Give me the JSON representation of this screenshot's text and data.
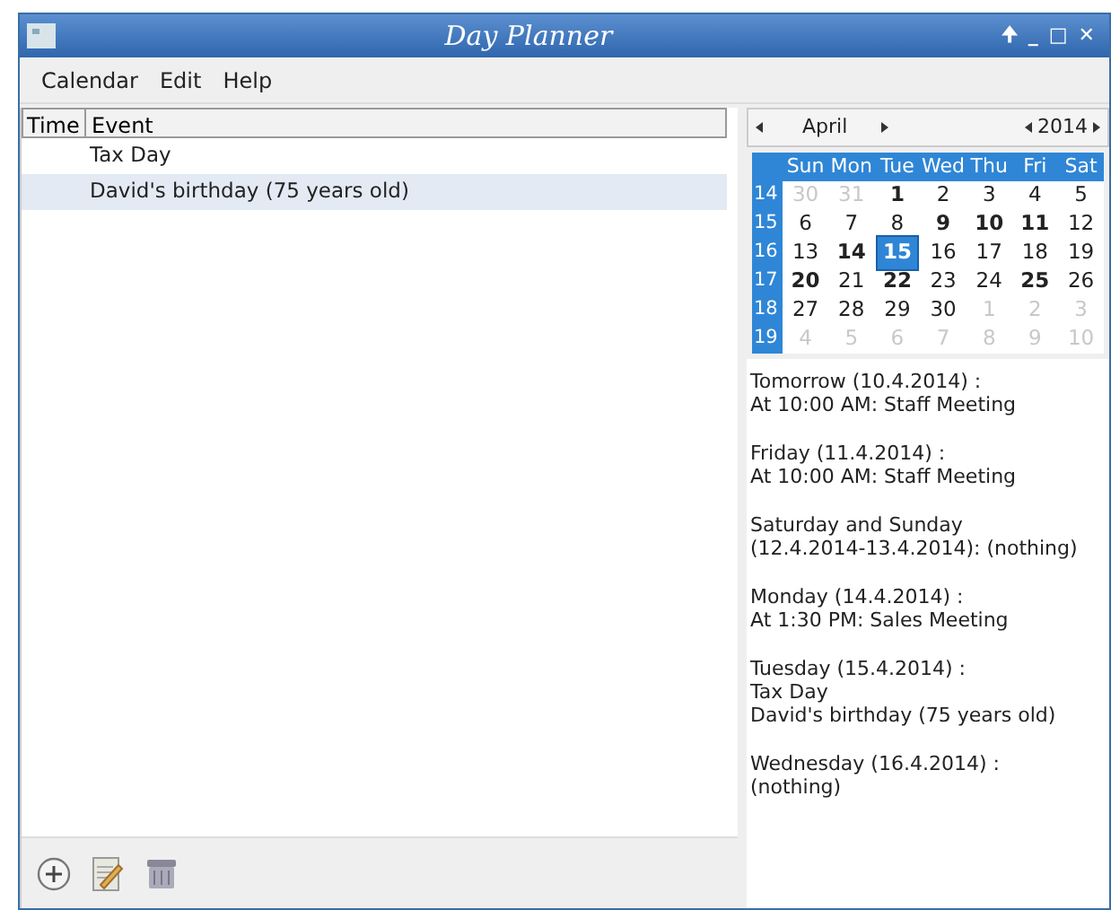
{
  "window": {
    "title": "Day Planner",
    "controls": [
      "🠉",
      "_",
      "□",
      "✕"
    ]
  },
  "menu": [
    "Calendar",
    "Edit",
    "Help"
  ],
  "table": {
    "columns": [
      "Time",
      "Event"
    ],
    "rows": [
      {
        "time": "",
        "event": "Tax Day",
        "selected": false
      },
      {
        "time": "",
        "event": "David's birthday (75 years old)",
        "selected": true
      }
    ]
  },
  "toolbar": [
    {
      "kind": "add"
    },
    {
      "kind": "edit"
    },
    {
      "kind": "delete"
    }
  ],
  "calendar": {
    "month": "April",
    "year": "2014",
    "weekdays": [
      "Sun",
      "Mon",
      "Tue",
      "Wed",
      "Thu",
      "Fri",
      "Sat"
    ],
    "weeks": [
      {
        "number": "14",
        "days": [
          {
            "day": "30",
            "muted": true,
            "bold": false,
            "selected": false
          },
          {
            "day": "31",
            "muted": true,
            "bold": false,
            "selected": false
          },
          {
            "day": "1",
            "muted": false,
            "bold": true,
            "selected": false
          },
          {
            "day": "2",
            "muted": false,
            "bold": false,
            "selected": false
          },
          {
            "day": "3",
            "muted": false,
            "bold": false,
            "selected": false
          },
          {
            "day": "4",
            "muted": false,
            "bold": false,
            "selected": false
          },
          {
            "day": "5",
            "muted": false,
            "bold": false,
            "selected": false
          }
        ]
      },
      {
        "number": "15",
        "days": [
          {
            "day": "6",
            "muted": false,
            "bold": false,
            "selected": false
          },
          {
            "day": "7",
            "muted": false,
            "bold": false,
            "selected": false
          },
          {
            "day": "8",
            "muted": false,
            "bold": false,
            "selected": false
          },
          {
            "day": "9",
            "muted": false,
            "bold": true,
            "selected": false
          },
          {
            "day": "10",
            "muted": false,
            "bold": true,
            "selected": false
          },
          {
            "day": "11",
            "muted": false,
            "bold": true,
            "selected": false
          },
          {
            "day": "12",
            "muted": false,
            "bold": false,
            "selected": false
          }
        ]
      },
      {
        "number": "16",
        "days": [
          {
            "day": "13",
            "muted": false,
            "bold": false,
            "selected": false
          },
          {
            "day": "14",
            "muted": false,
            "bold": true,
            "selected": false
          },
          {
            "day": "15",
            "muted": false,
            "bold": true,
            "selected": true
          },
          {
            "day": "16",
            "muted": false,
            "bold": false,
            "selected": false
          },
          {
            "day": "17",
            "muted": false,
            "bold": false,
            "selected": false
          },
          {
            "day": "18",
            "muted": false,
            "bold": false,
            "selected": false
          },
          {
            "day": "19",
            "muted": false,
            "bold": false,
            "selected": false
          }
        ]
      },
      {
        "number": "17",
        "days": [
          {
            "day": "20",
            "muted": false,
            "bold": true,
            "selected": false
          },
          {
            "day": "21",
            "muted": false,
            "bold": false,
            "selected": false
          },
          {
            "day": "22",
            "muted": false,
            "bold": true,
            "selected": false
          },
          {
            "day": "23",
            "muted": false,
            "bold": false,
            "selected": false
          },
          {
            "day": "24",
            "muted": false,
            "bold": false,
            "selected": false
          },
          {
            "day": "25",
            "muted": false,
            "bold": true,
            "selected": false
          },
          {
            "day": "26",
            "muted": false,
            "bold": false,
            "selected": false
          }
        ]
      },
      {
        "number": "18",
        "days": [
          {
            "day": "27",
            "muted": false,
            "bold": false,
            "selected": false
          },
          {
            "day": "28",
            "muted": false,
            "bold": false,
            "selected": false
          },
          {
            "day": "29",
            "muted": false,
            "bold": false,
            "selected": false
          },
          {
            "day": "30",
            "muted": false,
            "bold": false,
            "selected": false
          },
          {
            "day": "1",
            "muted": true,
            "bold": false,
            "selected": false
          },
          {
            "day": "2",
            "muted": true,
            "bold": false,
            "selected": false
          },
          {
            "day": "3",
            "muted": true,
            "bold": false,
            "selected": false
          }
        ]
      },
      {
        "number": "19",
        "days": [
          {
            "day": "4",
            "muted": true,
            "bold": false,
            "selected": false
          },
          {
            "day": "5",
            "muted": true,
            "bold": false,
            "selected": false
          },
          {
            "day": "6",
            "muted": true,
            "bold": false,
            "selected": false
          },
          {
            "day": "7",
            "muted": true,
            "bold": false,
            "selected": false
          },
          {
            "day": "8",
            "muted": true,
            "bold": false,
            "selected": false
          },
          {
            "day": "9",
            "muted": true,
            "bold": false,
            "selected": false
          },
          {
            "day": "10",
            "muted": true,
            "bold": false,
            "selected": false
          }
        ]
      }
    ]
  },
  "agenda": [
    [
      "Tomorrow (10.4.2014) :",
      "At 10:00 AM: Staff Meeting"
    ],
    [
      "Friday (11.4.2014) :",
      "At 10:00 AM: Staff Meeting"
    ],
    [
      "Saturday and Sunday",
      "(12.4.2014-13.4.2014): (nothing)"
    ],
    [
      "Monday (14.4.2014) :",
      "At 1:30 PM: Sales Meeting"
    ],
    [
      "Tuesday (15.4.2014) :",
      "Tax Day",
      "David's birthday (75 years old)"
    ],
    [
      "Wednesday (16.4.2014) :",
      "(nothing)"
    ]
  ]
}
